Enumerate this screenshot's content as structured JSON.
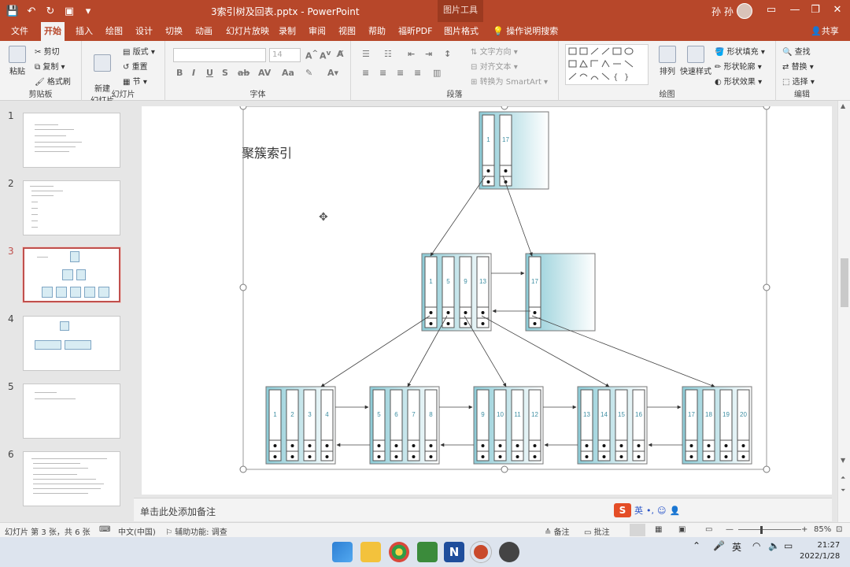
{
  "window": {
    "title": "3索引树及回表.pptx - PowerPoint",
    "context_tool": "图片工具",
    "user": "孙 孙"
  },
  "tabs": [
    "文件",
    "开始",
    "插入",
    "绘图",
    "设计",
    "切换",
    "动画",
    "幻灯片放映",
    "录制",
    "审阅",
    "视图",
    "帮助",
    "福昕PDF",
    "图片格式"
  ],
  "active_tab": "开始",
  "tell_me": "操作说明搜索",
  "share": "共享",
  "ribbon": {
    "clipboard": {
      "paste": "粘贴",
      "cut": "剪切",
      "copy": "复制",
      "format_painter": "格式刷",
      "label": "剪贴板"
    },
    "slides": {
      "new_slide": "新建\n幻灯片",
      "layout": "版式",
      "reset": "重置",
      "section": "节",
      "label": "幻灯片"
    },
    "font": {
      "size": "14",
      "label": "字体"
    },
    "paragraph": {
      "text_direction": "文字方向",
      "align_text": "对齐文本",
      "smartart": "转换为 SmartArt",
      "label": "段落"
    },
    "drawing": {
      "arrange": "排列",
      "quick_styles": "快速样式",
      "fill": "形状填充",
      "outline": "形状轮廓",
      "effects": "形状效果",
      "label": "绘图"
    },
    "editing": {
      "find": "查找",
      "replace": "替换",
      "select": "选择",
      "label": "编辑"
    }
  },
  "slides": [
    {
      "num": "1"
    },
    {
      "num": "2"
    },
    {
      "num": "3",
      "selected": true
    },
    {
      "num": "4"
    },
    {
      "num": "5"
    },
    {
      "num": "6"
    }
  ],
  "slide": {
    "title": "聚簇索引",
    "root": {
      "keys": [
        "1",
        "17"
      ]
    },
    "level2": [
      {
        "keys": [
          "1",
          "5",
          "9",
          "13"
        ]
      },
      {
        "keys": [
          "17"
        ]
      }
    ],
    "leaves": [
      {
        "keys": [
          "1",
          "2",
          "3",
          "4"
        ]
      },
      {
        "keys": [
          "5",
          "6",
          "7",
          "8"
        ]
      },
      {
        "keys": [
          "9",
          "10",
          "11",
          "12"
        ]
      },
      {
        "keys": [
          "13",
          "14",
          "15",
          "16"
        ]
      },
      {
        "keys": [
          "17",
          "18",
          "19",
          "20"
        ]
      }
    ]
  },
  "notes_placeholder": "单击此处添加备注",
  "ime": {
    "lang": "英"
  },
  "status": {
    "slide_info": "幻灯片 第 3 张，共 6 张",
    "language": "中文(中国)",
    "accessibility": "辅助功能: 调查",
    "notes": "备注",
    "comments": "批注",
    "zoom": "85%"
  },
  "taskbar": {
    "ime": "英",
    "time": "21:27",
    "date": "2022/1/28"
  }
}
